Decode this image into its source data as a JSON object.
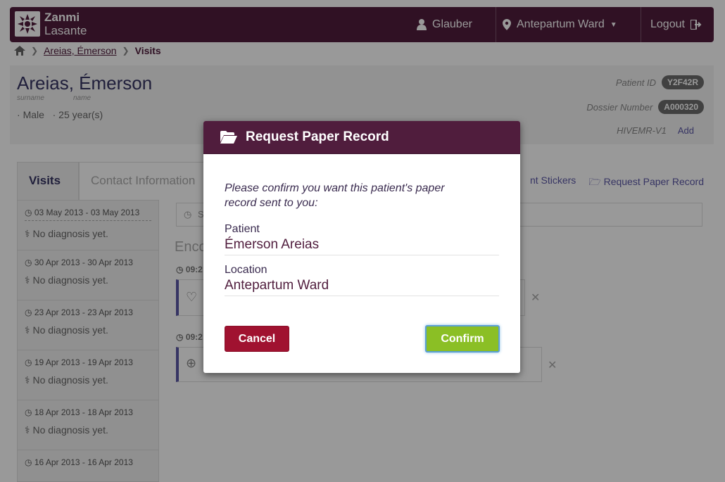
{
  "header": {
    "brand_line1": "Zanmi",
    "brand_line2": "Lasante",
    "user": "Glauber",
    "location": "Antepartum Ward",
    "logout": "Logout",
    "bg_color": "#501d3d"
  },
  "breadcrumb": {
    "patient": "Areias, Émerson",
    "current": "Visits"
  },
  "patient": {
    "name": "Areias, Émerson",
    "surname_label": "surname",
    "name_label": "name",
    "gender": "Male",
    "age": "25 year(s)",
    "id_label": "Patient ID",
    "id_value": "Y2F42R",
    "dossier_label": "Dossier Number",
    "dossier_value": "A000320",
    "emr_label": "HIVEMR-V1",
    "add_link": "Add"
  },
  "tabs": {
    "visits": "Visits",
    "contact": "Contact Information",
    "print_stickers": "nt Stickers",
    "request_paper": "Request Paper Record"
  },
  "visits": [
    {
      "dates": "03 May 2013 - 03 May 2013",
      "diagnosis": "No diagnosis yet."
    },
    {
      "dates": "30 Apr 2013 - 30 Apr 2013",
      "diagnosis": "No diagnosis yet."
    },
    {
      "dates": "23 Apr 2013 - 23 Apr 2013",
      "diagnosis": "No diagnosis yet."
    },
    {
      "dates": "19 Apr 2013 - 19 Apr 2013",
      "diagnosis": "No diagnosis yet."
    },
    {
      "dates": "18 Apr 2013 - 18 Apr 2013",
      "diagnosis": "No diagnosis yet."
    },
    {
      "dates": "16 Apr 2013 - 16 Apr 2013",
      "diagnosis": ""
    }
  ],
  "encounters": {
    "title_partial": "Enco",
    "time1": "09:2",
    "time2": "09:2",
    "search_partial": "S"
  },
  "modal": {
    "title": "Request Paper Record",
    "confirm_text": "Please confirm you want this patient's paper record sent to you:",
    "patient_label": "Patient",
    "patient_value": "Émerson Areias",
    "location_label": "Location",
    "location_value": "Antepartum Ward",
    "cancel_label": "Cancel",
    "confirm_label": "Confirm"
  }
}
